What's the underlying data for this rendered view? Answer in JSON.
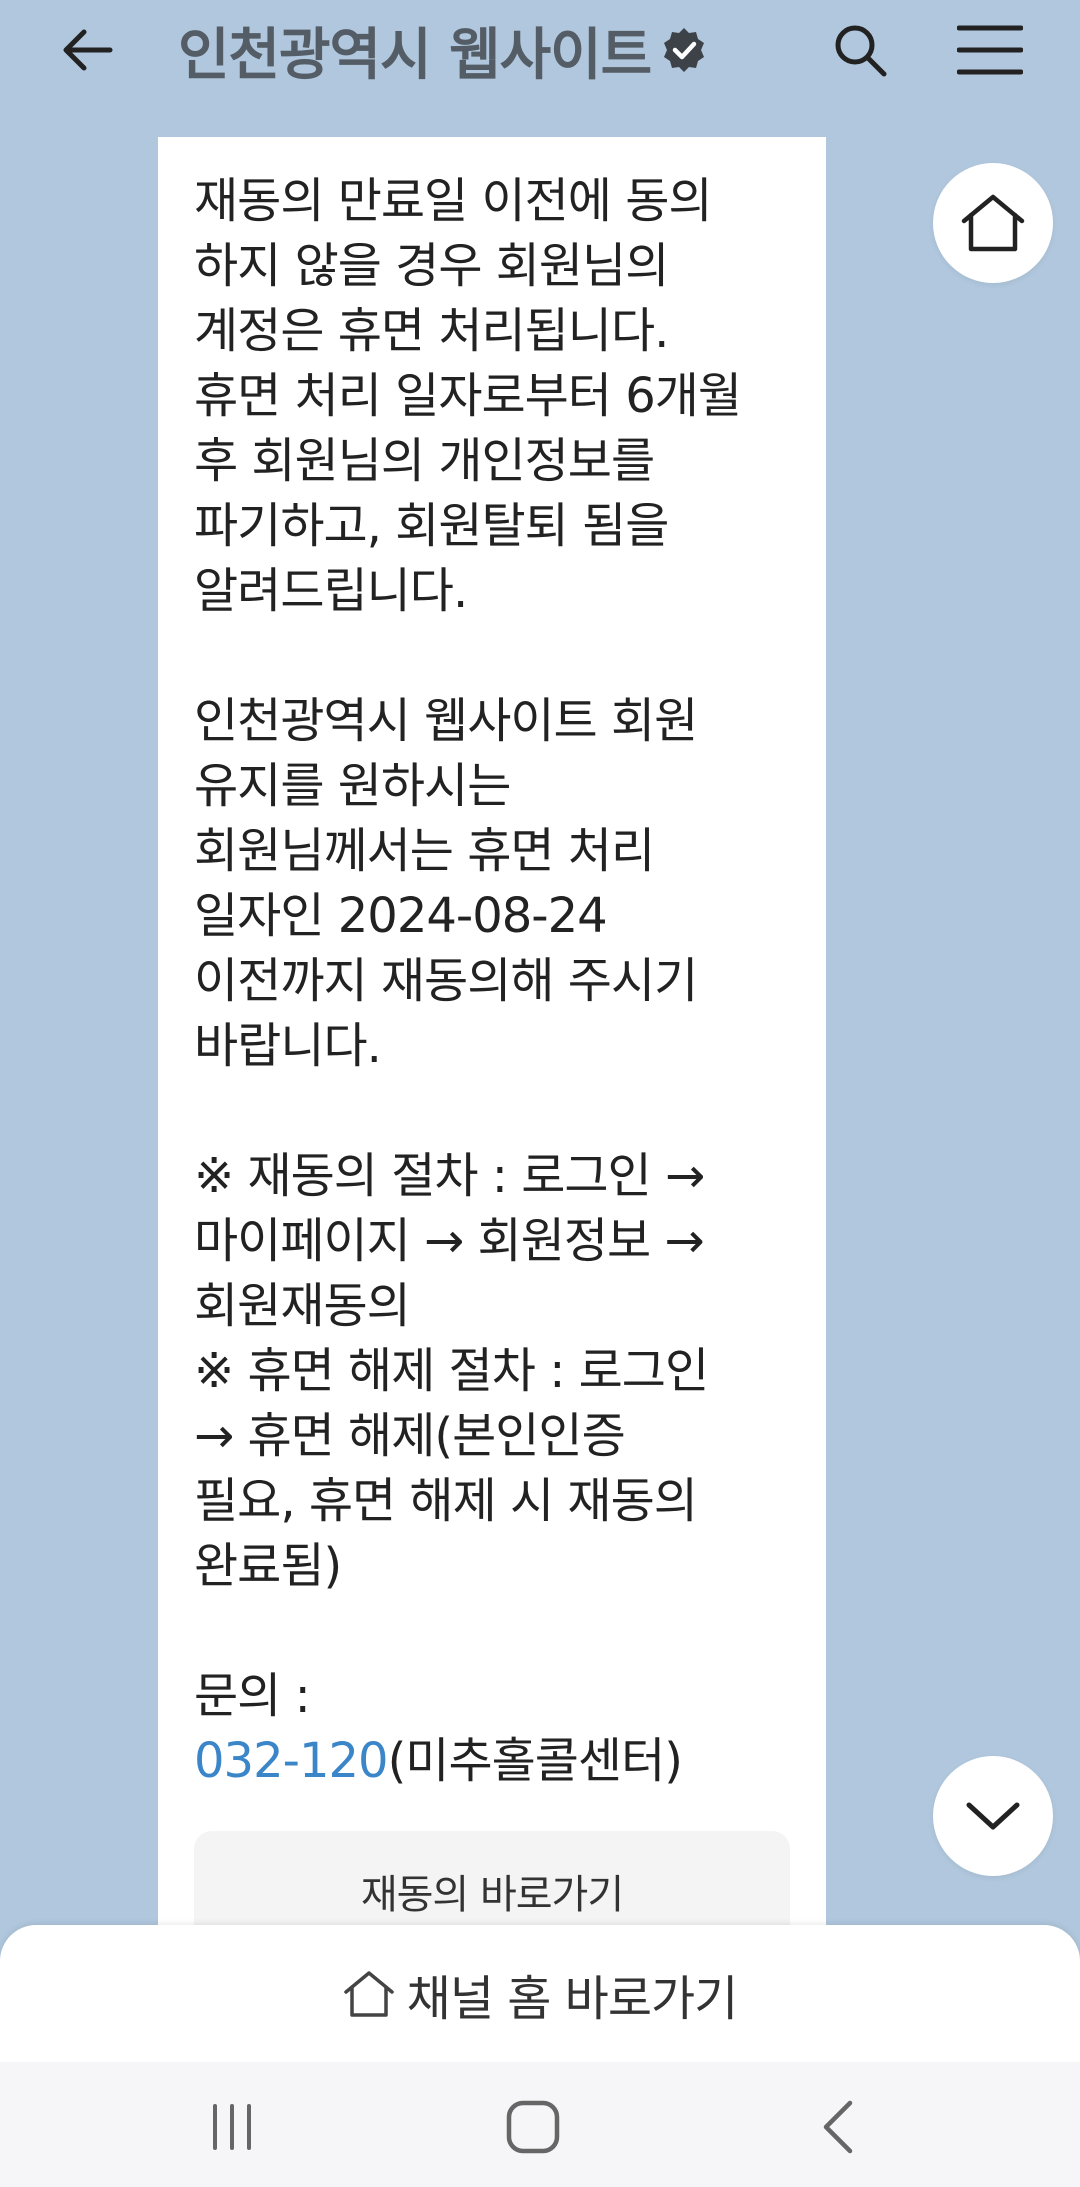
{
  "header": {
    "title": "인천광역시 웹사이트",
    "icons": {
      "back": "arrow-left-icon",
      "verified": "verified-badge-icon",
      "search": "search-icon",
      "menu": "hamburger-menu-icon"
    }
  },
  "message": {
    "lines_p1": [
      "재동의 만료일 이전에 동의",
      "하지 않을 경우 회원님의",
      "계정은 휴면 처리됩니다.",
      "휴면 처리 일자로부터 6개월",
      "후 회원님의 개인정보를",
      "파기하고, 회원탈퇴 됨을",
      "알려드립니다."
    ],
    "lines_p2": [
      "인천광역시 웹사이트 회원",
      "유지를 원하시는",
      "회원님께서는 휴면 처리",
      "일자인 2024-08-24",
      "이전까지 재동의해 주시기",
      "바랍니다."
    ],
    "lines_p3": [
      "※ 재동의 절차 : 로그인 →",
      "마이페이지 → 회원정보 →",
      "회원재동의",
      "※ 휴면 해제 절차 : 로그인",
      "→ 휴면 해제(본인인증",
      "필요, 휴면 해제 시 재동의",
      "완료됨)"
    ],
    "contact_label": "문의 :",
    "phone": "032-120",
    "phone_suffix": "(미추홀콜센터)",
    "link_color": "#3b86c9"
  },
  "action_button": {
    "label": "재동의 바로가기"
  },
  "floating": {
    "home_icon": "home-icon",
    "down_icon": "chevron-down-icon"
  },
  "bottom_bar": {
    "channel_home_label": "채널 홈 바로가기",
    "icon": "home-outline-icon"
  },
  "nav_bar": {
    "recent_icon": "recent-apps-icon",
    "home_icon": "home-square-icon",
    "back_icon": "back-chevron-icon"
  },
  "colors": {
    "background": "#b0c7dd",
    "title": "#545c66",
    "card": "#ffffff"
  }
}
